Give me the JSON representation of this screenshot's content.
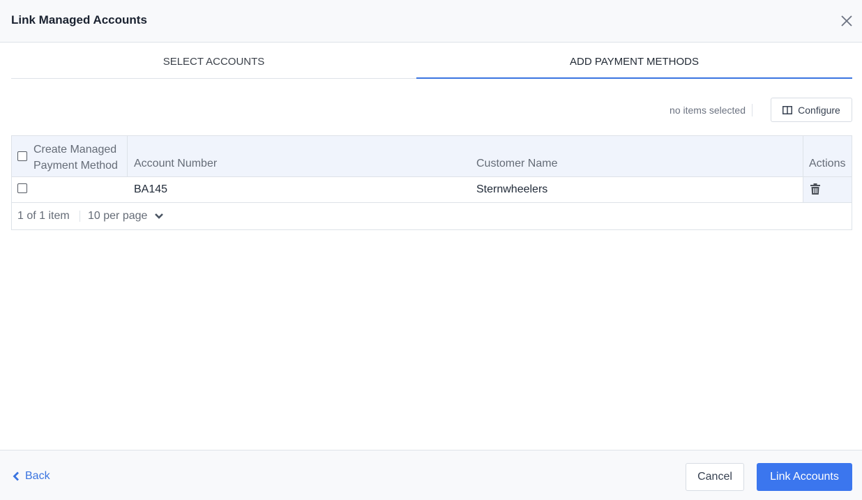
{
  "dialog": {
    "title": "Link Managed Accounts",
    "close_icon": "close-icon"
  },
  "tabs": [
    {
      "label": "SELECT ACCOUNTS",
      "active": false
    },
    {
      "label": "ADD PAYMENT METHODS",
      "active": true
    }
  ],
  "toolbar": {
    "selection_status": "no items selected",
    "configure_label": "Configure",
    "configure_icon": "columns-icon"
  },
  "table": {
    "columns": [
      {
        "label": "Create Managed Payment Method",
        "line1": "Create Managed",
        "line2": "Payment Method"
      },
      {
        "label": "Account Number"
      },
      {
        "label": "Customer Name"
      },
      {
        "label": "Actions"
      }
    ],
    "rows": [
      {
        "selected": false,
        "account_number": "BA145",
        "customer_name": "Sternwheelers",
        "action_icon": "trash-icon"
      }
    ],
    "pager": {
      "count": "1 of 1 item",
      "per_page": "10 per page"
    }
  },
  "footer": {
    "back_label": "Back",
    "cancel_label": "Cancel",
    "primary_label": "Link Accounts"
  },
  "colors": {
    "accent": "#3b76ee",
    "header_bg": "#f8f9fb",
    "table_header_bg": "#f0f4fc"
  }
}
